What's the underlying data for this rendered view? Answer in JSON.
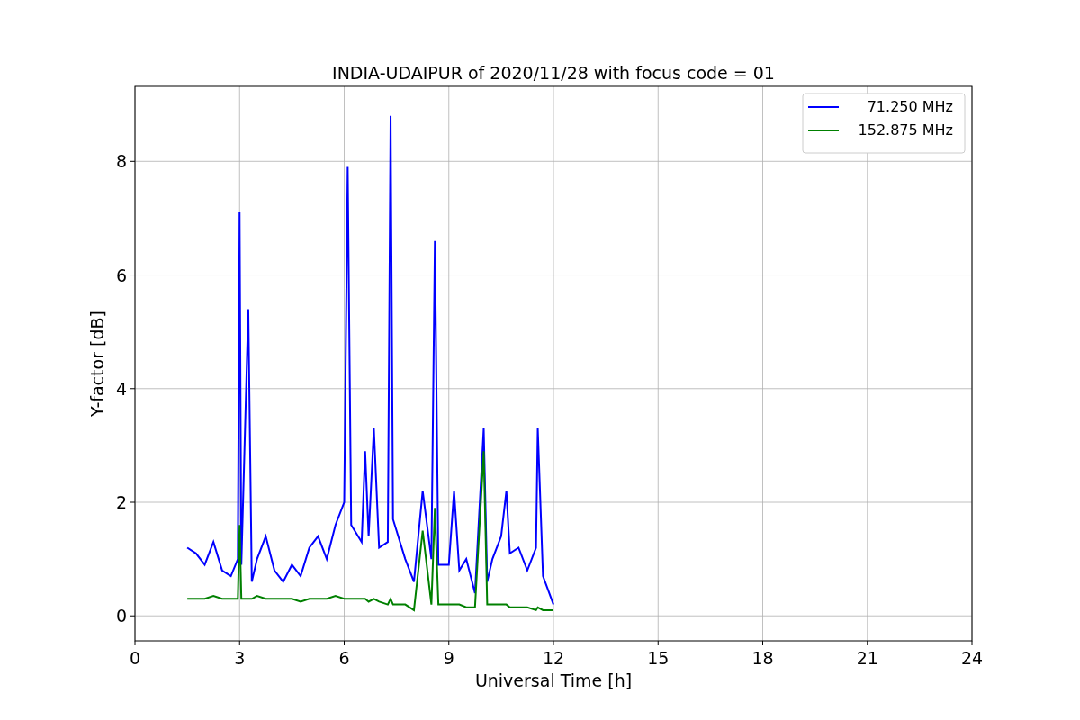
{
  "chart_data": {
    "type": "line",
    "title": "INDIA-UDAIPUR of 2020/11/28 with focus code = 01",
    "xlabel": "Universal Time [h]",
    "ylabel": "Y-factor [dB]",
    "x": [
      1.5,
      1.75,
      2.0,
      2.25,
      2.5,
      2.75,
      2.95,
      3.0,
      3.05,
      3.25,
      3.35,
      3.5,
      3.75,
      4.0,
      4.25,
      4.5,
      4.75,
      5.0,
      5.25,
      5.5,
      5.75,
      6.0,
      6.1,
      6.2,
      6.5,
      6.6,
      6.7,
      6.85,
      7.0,
      7.25,
      7.33,
      7.4,
      7.75,
      8.0,
      8.25,
      8.5,
      8.6,
      8.7,
      9.0,
      9.15,
      9.3,
      9.5,
      9.75,
      10.0,
      10.1,
      10.25,
      10.5,
      10.65,
      10.75,
      11.0,
      11.25,
      11.5,
      11.55,
      11.7,
      12.0
    ],
    "series": [
      {
        "name": "71.250 MHz",
        "color": "#0000ff",
        "values": [
          1.2,
          1.1,
          0.9,
          1.3,
          0.8,
          0.7,
          1.0,
          7.1,
          0.9,
          5.4,
          0.6,
          1.0,
          1.4,
          0.8,
          0.6,
          0.9,
          0.7,
          1.2,
          1.4,
          1.0,
          1.6,
          2.0,
          7.9,
          1.6,
          1.3,
          2.9,
          1.4,
          3.3,
          1.2,
          1.3,
          8.8,
          1.7,
          1.0,
          0.6,
          2.2,
          1.0,
          6.6,
          0.9,
          0.9,
          2.2,
          0.8,
          1.0,
          0.4,
          3.3,
          0.6,
          1.0,
          1.4,
          2.2,
          1.1,
          1.2,
          0.8,
          1.2,
          3.3,
          0.7,
          0.2
        ]
      },
      {
        "name": "152.875 MHz",
        "color": "#008000",
        "values": [
          0.3,
          0.3,
          0.3,
          0.35,
          0.3,
          0.3,
          0.3,
          1.6,
          0.3,
          0.3,
          0.3,
          0.35,
          0.3,
          0.3,
          0.3,
          0.3,
          0.25,
          0.3,
          0.3,
          0.3,
          0.35,
          0.3,
          0.3,
          0.3,
          0.3,
          0.3,
          0.25,
          0.3,
          0.25,
          0.2,
          0.3,
          0.2,
          0.2,
          0.1,
          1.5,
          0.2,
          1.9,
          0.2,
          0.2,
          0.2,
          0.2,
          0.15,
          0.15,
          2.9,
          0.2,
          0.2,
          0.2,
          0.2,
          0.15,
          0.15,
          0.15,
          0.1,
          0.15,
          0.1,
          0.1
        ]
      }
    ],
    "grid": true,
    "legend": true,
    "xlim": [
      0,
      24
    ],
    "ylim": [
      -0.44,
      9.32
    ],
    "xticks": [
      0,
      3,
      6,
      9,
      12,
      15,
      18,
      21,
      24
    ],
    "yticks": [
      0,
      2,
      4,
      6,
      8
    ]
  }
}
